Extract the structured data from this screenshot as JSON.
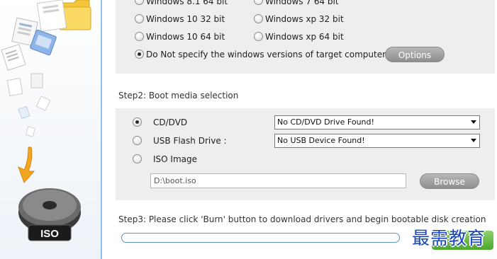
{
  "os_options": {
    "win81_64": "Windows 8.1 64 bit",
    "win7_64": "Windows 7 64 bit",
    "win10_32": "Windows 10 32 bit",
    "winxp_32": "Windows xp 32 bit",
    "win10_64": "Windows 10 64 bit",
    "winxp_64": "Windows xp 64 bit",
    "no_spec": "Do Not specify the windows versions of target computer.",
    "selected": "no_spec",
    "options_button": "Options"
  },
  "step2": {
    "title": "Step2: Boot media selection",
    "cd_label": "CD/DVD",
    "usb_label": "USB Flash Drive :",
    "iso_label": "ISO Image",
    "selected": "cd",
    "cd_select": "No CD/DVD Drive Found!",
    "usb_select": "No USB Device Found!",
    "iso_path": "D:\\boot.iso",
    "browse_button": "Browse"
  },
  "step3": {
    "title": "Step3: Please click 'Burn' button to download drivers and begin bootable disk creation",
    "progress": 0
  },
  "sidebar": {
    "iso_badge": "ISO"
  },
  "watermark": "最需教育",
  "colors": {
    "panel_bg": "#eeeeee",
    "sidebar_border": "#8fc0ea",
    "progress_border": "#5f93c9",
    "burn_green": "#4fa82f",
    "watermark_blue": "#1b46b8"
  }
}
